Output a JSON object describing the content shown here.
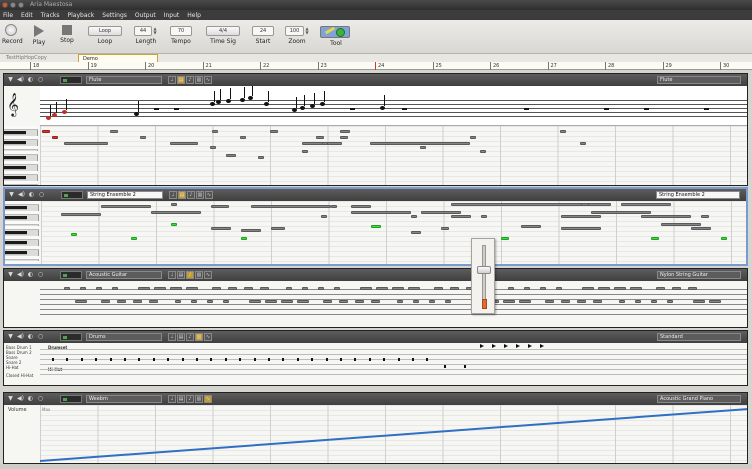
{
  "window": {
    "title": "Aria Maestosa"
  },
  "menu": [
    "File",
    "Edit",
    "Tracks",
    "Playback",
    "Settings",
    "Output",
    "Input",
    "Help"
  ],
  "toolbar": {
    "record_label": "Record",
    "play_label": "Play",
    "stop_label": "Stop",
    "loop_label": "Loop",
    "loop_button": "Loop",
    "length_label": "Length",
    "length_value": "44",
    "tempo_label": "Tempo",
    "tempo_value": "70",
    "timesig_label": "Time Sig",
    "timesig_value": "4/4",
    "start_label": "Start",
    "start_value": "24",
    "zoom_label": "Zoom",
    "zoom_value": "100",
    "tool_label": "Tool"
  },
  "sequence_tabs": [
    {
      "label": "TestHipHopCopy",
      "active": false
    },
    {
      "label": "Demo",
      "active": true
    }
  ],
  "ruler": {
    "measures": [
      "18",
      "19",
      "20",
      "21",
      "22",
      "23",
      "24",
      "25",
      "26",
      "27",
      "28",
      "29",
      "30"
    ]
  },
  "tracks": [
    {
      "name": "Flute",
      "instrument": "Flute",
      "view": "score+keyboard",
      "selected": false,
      "light_name": false
    },
    {
      "name": "String Ensemble 2",
      "instrument": "String Ensemble 2",
      "view": "keyboard",
      "selected": true,
      "light_name": true
    },
    {
      "name": "Acoustic Guitar",
      "instrument": "Nylon String Guitar",
      "view": "guitar tablature",
      "selected": false,
      "light_name": false
    },
    {
      "name": "Drums",
      "instrument": "Standard",
      "view": "drums",
      "selected": false,
      "light_name": false
    },
    {
      "name": "Weebm",
      "instrument": "Acoustic Grand Piano",
      "view": "controller",
      "selected": false,
      "light_name": false
    }
  ],
  "drums": {
    "names": [
      "Bass Drum 1",
      "Bass Drum 2",
      "Snare",
      "Snare 2",
      "Hi-Hat",
      "Closed Hi-Hat"
    ],
    "group_labels": [
      "Drumset",
      "Hi-Hat"
    ]
  },
  "controller": {
    "label": "Volume",
    "max_label": "Max"
  },
  "volume_popup": {
    "level": 0.62
  },
  "colors": {
    "selected_track_border": "#7b9bd0",
    "green_note": "#39e039",
    "controller_line": "#2f6fc4"
  }
}
